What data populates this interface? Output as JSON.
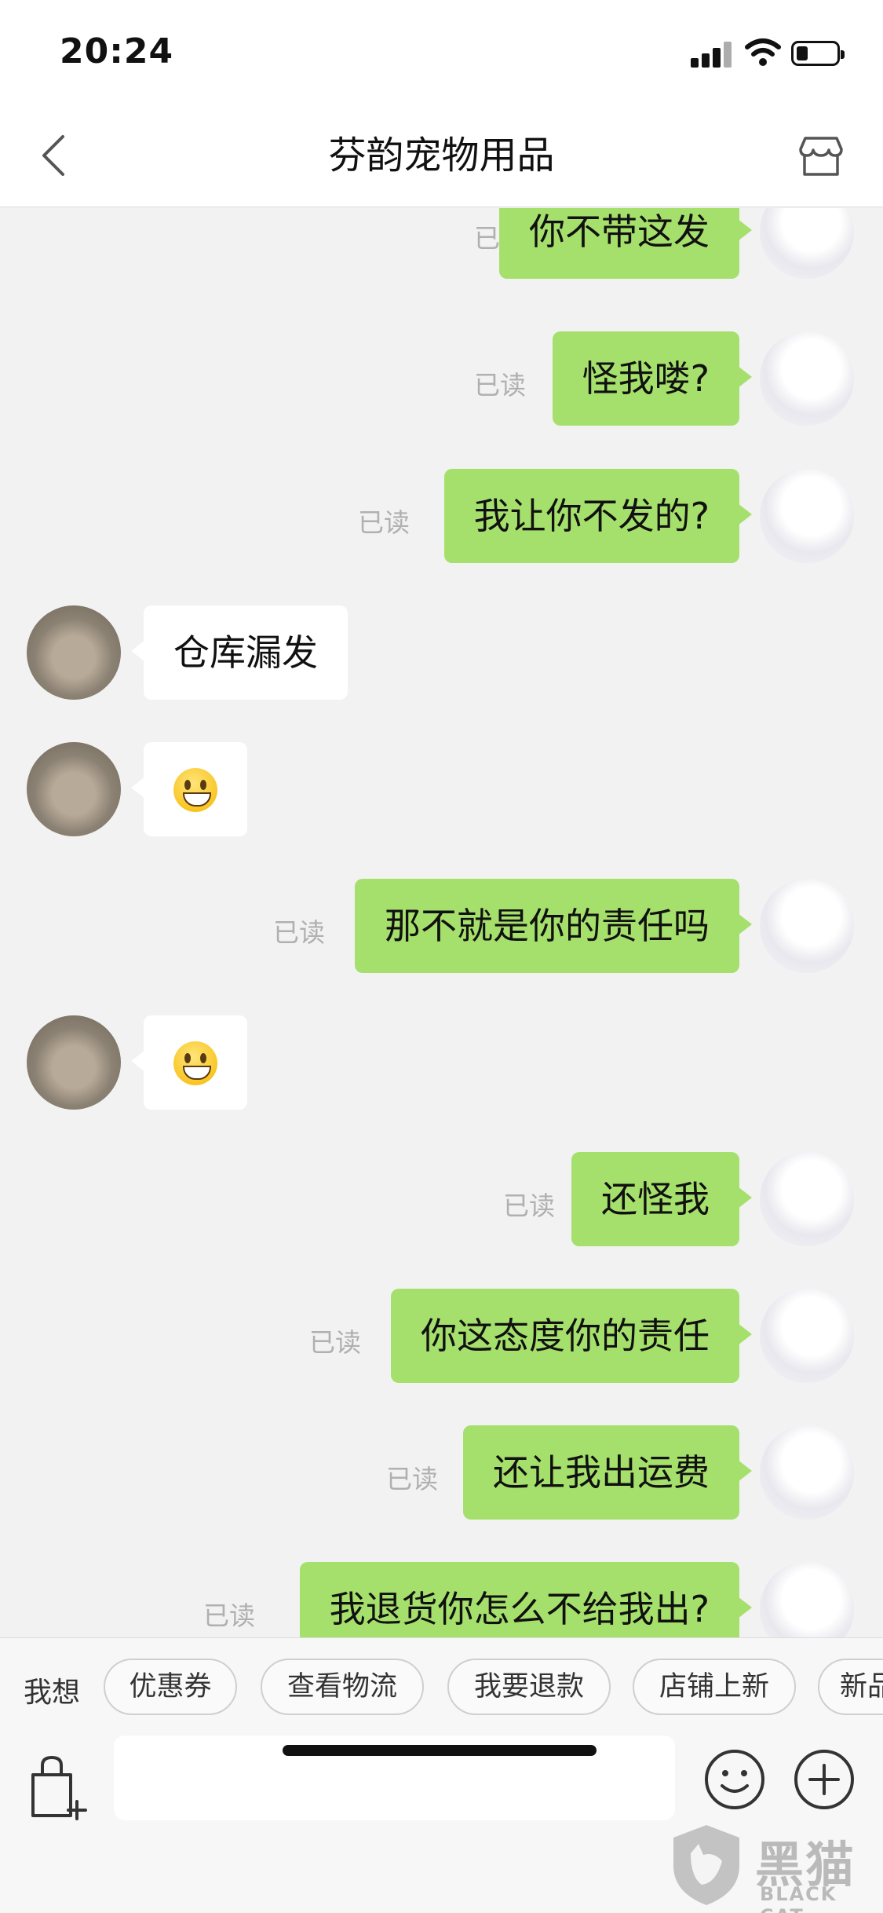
{
  "status_bar": {
    "time": "20:24"
  },
  "header": {
    "title": "芬韵宠物用品"
  },
  "messages": [
    {
      "side": "out",
      "text": "你不带这发",
      "read": "已读"
    },
    {
      "side": "out",
      "text": "怪我喽?",
      "read": "已读"
    },
    {
      "side": "out",
      "text": "我让你不发的?",
      "read": "已读"
    },
    {
      "side": "in",
      "text": "仓库漏发"
    },
    {
      "side": "in",
      "emoji": "grinning-face"
    },
    {
      "side": "out",
      "text": "那不就是你的责任吗",
      "read": "已读"
    },
    {
      "side": "in",
      "emoji": "grinning-face"
    },
    {
      "side": "out",
      "text": "还怪我",
      "read": "已读"
    },
    {
      "side": "out",
      "text": "你这态度你的责任",
      "read": "已读"
    },
    {
      "side": "out",
      "text": "还让我出运费",
      "read": "已读"
    },
    {
      "side": "out",
      "text": "我退货你怎么不给我出?",
      "read": "已读"
    }
  ],
  "quick_bar": {
    "label": "我想",
    "chips": [
      "优惠券",
      "查看物流",
      "我要退款",
      "店铺上新",
      "新品"
    ]
  },
  "input": {
    "placeholder": ""
  },
  "icons": {
    "back": "chevron-left-icon",
    "store": "store-icon",
    "bag": "shopping-bag-icon",
    "emoji": "smile-icon",
    "plus": "plus-circle-icon"
  },
  "colors": {
    "outgoing_bubble": "#a6e06c",
    "incoming_bubble": "#ffffff",
    "background": "#f2f2f2"
  },
  "watermark": {
    "cn": "黑猫",
    "en": "BLACK CAT"
  }
}
